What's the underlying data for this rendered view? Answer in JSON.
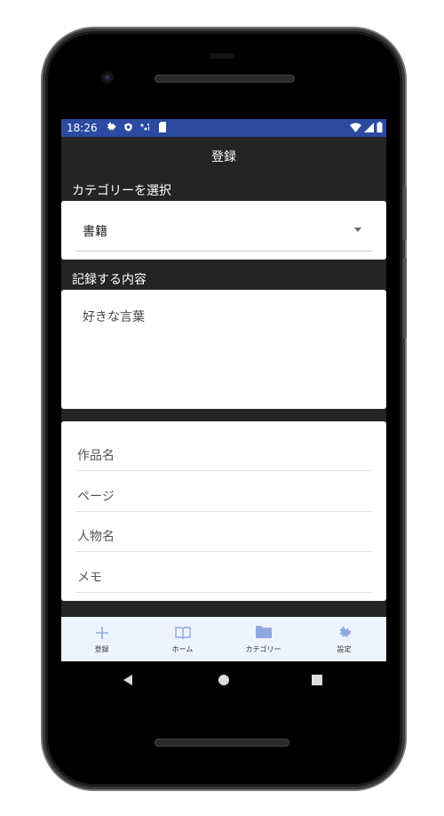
{
  "status_bar": {
    "time": "18:26"
  },
  "app": {
    "title": "登録"
  },
  "category_section": {
    "label": "カテゴリーを選択",
    "selected": "書籍"
  },
  "content_section": {
    "label": "記録する内容",
    "value": "好きな言葉"
  },
  "details": {
    "fields": [
      {
        "placeholder": "作品名"
      },
      {
        "placeholder": "ページ"
      },
      {
        "placeholder": "人物名"
      },
      {
        "placeholder": "メモ"
      }
    ]
  },
  "bottom_nav": {
    "items": [
      {
        "label": "登録",
        "icon": "plus-icon"
      },
      {
        "label": "ホーム",
        "icon": "book-icon"
      },
      {
        "label": "カテゴリー",
        "icon": "folder-icon"
      },
      {
        "label": "設定",
        "icon": "gear-icon"
      }
    ],
    "accent": "#90a8e0"
  },
  "colors": {
    "status_bar": "#2b4aa0",
    "background": "#242424",
    "nav_background": "#eef4fd"
  }
}
